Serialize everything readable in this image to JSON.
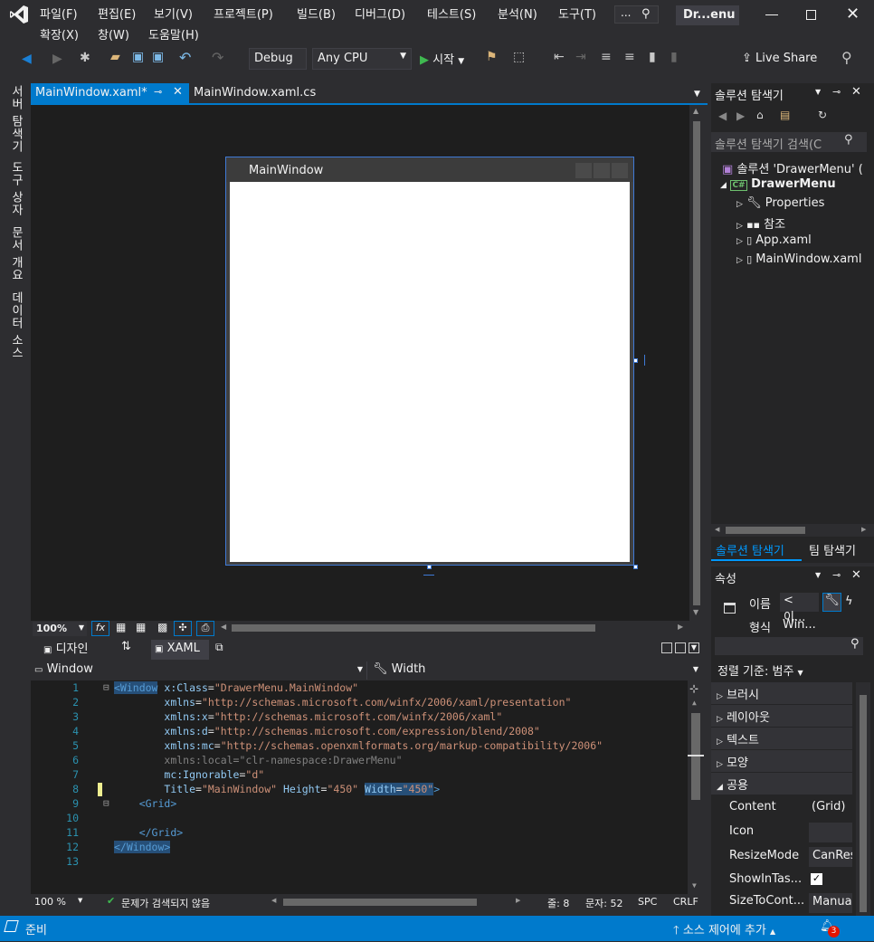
{
  "menu": {
    "items": [
      "파일(F)",
      "편집(E)",
      "보기(V)",
      "프로젝트(P)",
      "빌드(B)",
      "디버그(D)",
      "테스트(S)",
      "분석(N)",
      "도구(T)"
    ],
    "items2": [
      "확장(X)",
      "창(W)",
      "도움말(H)"
    ],
    "search_label": "...",
    "solution_badge": "Dr...enu"
  },
  "toolbar": {
    "config": "Debug",
    "platform": "Any CPU",
    "start": "시작",
    "live_share": "Live Share"
  },
  "leftbar": [
    "서버 탐색기",
    "도구 상자",
    "문서 개요",
    "데이터 소스"
  ],
  "tabs": {
    "active": "MainWindow.xaml*",
    "second": "MainWindow.xaml.cs"
  },
  "designer": {
    "window_title": "MainWindow",
    "zoom": "100%",
    "split_design": "디자인",
    "split_xaml": "XAML",
    "nav_left": "Window",
    "nav_right": "Width"
  },
  "code": {
    "lines": [
      {
        "n": "1",
        "parts": [
          [
            "el",
            "<Window"
          ],
          [
            "def",
            " "
          ],
          [
            "at",
            "x:Class"
          ],
          [
            "def",
            "="
          ],
          [
            "v",
            "\"DrawerMenu.MainWindow\""
          ]
        ]
      },
      {
        "n": "2",
        "parts": [
          [
            "def",
            "        "
          ],
          [
            "at",
            "xmlns"
          ],
          [
            "def",
            "="
          ],
          [
            "v",
            "\"http://schemas.microsoft.com/winfx/2006/xaml/presentation\""
          ]
        ]
      },
      {
        "n": "3",
        "parts": [
          [
            "def",
            "        "
          ],
          [
            "at",
            "xmlns:x"
          ],
          [
            "def",
            "="
          ],
          [
            "v",
            "\"http://schemas.microsoft.com/winfx/2006/xaml\""
          ]
        ]
      },
      {
        "n": "4",
        "parts": [
          [
            "def",
            "        "
          ],
          [
            "at",
            "xmlns:d"
          ],
          [
            "def",
            "="
          ],
          [
            "v",
            "\"http://schemas.microsoft.com/expression/blend/2008\""
          ]
        ]
      },
      {
        "n": "5",
        "parts": [
          [
            "def",
            "        "
          ],
          [
            "at",
            "xmlns:mc"
          ],
          [
            "def",
            "="
          ],
          [
            "v",
            "\"http://schemas.openxmlformats.org/markup-compatibility/2006\""
          ]
        ]
      },
      {
        "n": "6",
        "parts": [
          [
            "def",
            "        "
          ],
          [
            "p",
            "xmlns:local=\"clr-namespace:DrawerMenu\""
          ]
        ]
      },
      {
        "n": "7",
        "parts": [
          [
            "def",
            "        "
          ],
          [
            "at",
            "mc:Ignorable"
          ],
          [
            "def",
            "="
          ],
          [
            "v",
            "\"d\""
          ]
        ]
      },
      {
        "n": "8",
        "parts": [
          [
            "def",
            "        "
          ],
          [
            "at",
            "Title"
          ],
          [
            "def",
            "="
          ],
          [
            "v",
            "\"MainWindow\""
          ],
          [
            "def",
            " "
          ],
          [
            "at",
            "Height"
          ],
          [
            "def",
            "="
          ],
          [
            "v",
            "\"450\""
          ],
          [
            "def",
            " "
          ],
          [
            "at",
            "Width"
          ],
          [
            "def",
            "="
          ],
          [
            "v",
            "\"450\""
          ],
          [
            "el",
            ">"
          ]
        ]
      },
      {
        "n": "9",
        "parts": [
          [
            "def",
            "    "
          ],
          [
            "el",
            "<Grid>"
          ]
        ]
      },
      {
        "n": "10",
        "parts": []
      },
      {
        "n": "11",
        "parts": [
          [
            "def",
            "    "
          ],
          [
            "el",
            "</Grid>"
          ]
        ]
      },
      {
        "n": "12",
        "parts": [
          [
            "el",
            "</Window>"
          ]
        ]
      },
      {
        "n": "13",
        "parts": []
      }
    ]
  },
  "editor_status": {
    "zoom": "100 %",
    "issues": "문제가 검색되지 않음",
    "line": "줄: 8",
    "char": "문자: 52",
    "spc": "SPC",
    "crlf": "CRLF"
  },
  "solution": {
    "title": "솔루션 탐색기",
    "search": "솔루션 탐색기 검색(C",
    "root": "솔루션 'DrawerMenu' (",
    "project": "DrawerMenu",
    "items": [
      "Properties",
      "참조",
      "App.xaml",
      "MainWindow.xaml"
    ],
    "tab1": "솔루션 탐색기",
    "tab2": "팀 탐색기"
  },
  "props": {
    "title": "속성",
    "name_label": "이름",
    "name_value": "<이...",
    "type_label": "형식",
    "type_value": "Win...",
    "sort": "정렬 기준: 범주",
    "categories": [
      "브러시",
      "레이아웃",
      "텍스트",
      "모양",
      "공용"
    ],
    "rows": [
      {
        "k": "Content",
        "v": "(Grid)"
      },
      {
        "k": "Icon",
        "v": ""
      },
      {
        "k": "ResizeMode",
        "v": "CanRes"
      },
      {
        "k": "ShowInTas...",
        "v": "checked"
      },
      {
        "k": "SizeToCont...",
        "v": "Manua"
      }
    ]
  },
  "status": {
    "ready": "준비",
    "source_control": "소스 제어에 추가",
    "notifications": "3"
  }
}
